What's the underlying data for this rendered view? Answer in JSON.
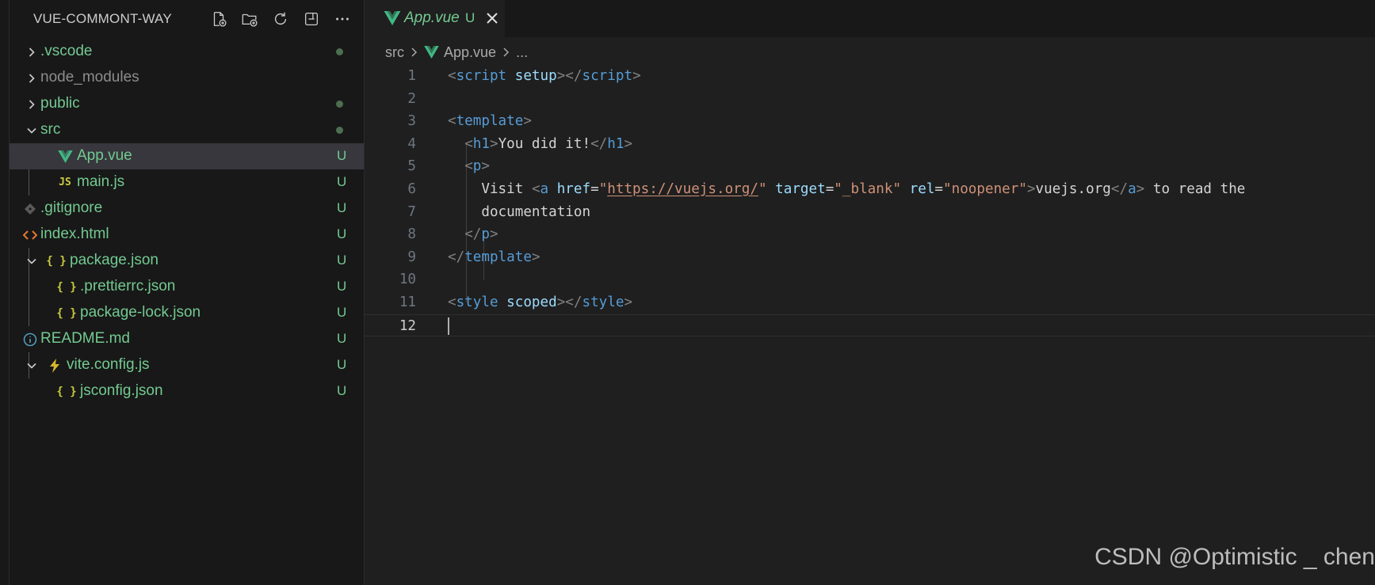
{
  "explorer": {
    "title": "VUE-COMMONT-WAY",
    "actions": [
      "new-file-icon",
      "new-folder-icon",
      "refresh-icon",
      "collapse-all-icon",
      "more-icon"
    ],
    "items": [
      {
        "name": ".vscode",
        "kind": "folder",
        "expanded": false,
        "indent": 0,
        "status": "dot",
        "color": "#73c991"
      },
      {
        "name": "node_modules",
        "kind": "folder",
        "expanded": false,
        "indent": 0,
        "status": "",
        "color": "#8c8c8c"
      },
      {
        "name": "public",
        "kind": "folder",
        "expanded": false,
        "indent": 0,
        "status": "dot",
        "color": "#73c991"
      },
      {
        "name": "src",
        "kind": "folder",
        "expanded": true,
        "indent": 0,
        "status": "dot",
        "color": "#73c991"
      },
      {
        "name": "App.vue",
        "kind": "vue",
        "indent": 1,
        "status": "U",
        "color": "#73c991",
        "selected": true
      },
      {
        "name": "main.js",
        "kind": "js",
        "indent": 1,
        "status": "U",
        "color": "#73c991"
      },
      {
        "name": ".gitignore",
        "kind": "git",
        "indent": 0,
        "status": "U",
        "color": "#73c991"
      },
      {
        "name": "index.html",
        "kind": "html",
        "indent": 0,
        "status": "U",
        "color": "#73c991"
      },
      {
        "name": "package.json",
        "kind": "json",
        "expanded": true,
        "indent": 0,
        "status": "U",
        "color": "#73c991"
      },
      {
        "name": ".prettierrc.json",
        "kind": "json",
        "indent": 1,
        "status": "U",
        "color": "#73c991"
      },
      {
        "name": "package-lock.json",
        "kind": "json",
        "indent": 1,
        "status": "U",
        "color": "#73c991"
      },
      {
        "name": "README.md",
        "kind": "info",
        "indent": 0,
        "status": "U",
        "color": "#73c991"
      },
      {
        "name": "vite.config.js",
        "kind": "vite",
        "expanded": true,
        "indent": 0,
        "status": "U",
        "color": "#73c991"
      },
      {
        "name": "jsconfig.json",
        "kind": "json",
        "indent": 1,
        "status": "U",
        "color": "#73c991"
      }
    ]
  },
  "tab": {
    "label": "App.vue",
    "status": "U",
    "close_icon": "close-icon"
  },
  "breadcrumb": {
    "folder": "src",
    "file": "App.vue",
    "more": "..."
  },
  "editor": {
    "active_line": 12,
    "lines": [
      {
        "n": "1",
        "tokens": [
          [
            "br",
            "<"
          ],
          [
            "tag",
            "script"
          ],
          [
            "t",
            " "
          ],
          [
            "attr",
            "setup"
          ],
          [
            "br",
            "></"
          ],
          [
            "tag",
            "script"
          ],
          [
            "br",
            ">"
          ]
        ]
      },
      {
        "n": "2",
        "tokens": []
      },
      {
        "n": "3",
        "tokens": [
          [
            "br",
            "<"
          ],
          [
            "tag",
            "template"
          ],
          [
            "br",
            ">"
          ]
        ]
      },
      {
        "n": "4",
        "tokens": [
          [
            "t",
            "  "
          ],
          [
            "br",
            "<"
          ],
          [
            "tag",
            "h1"
          ],
          [
            "br",
            ">"
          ],
          [
            "t",
            "You did it!"
          ],
          [
            "br",
            "</"
          ],
          [
            "tag",
            "h1"
          ],
          [
            "br",
            ">"
          ]
        ]
      },
      {
        "n": "5",
        "tokens": [
          [
            "t",
            "  "
          ],
          [
            "br",
            "<"
          ],
          [
            "tag",
            "p"
          ],
          [
            "br",
            ">"
          ]
        ]
      },
      {
        "n": "6",
        "tokens": [
          [
            "t",
            "    Visit "
          ],
          [
            "br",
            "<"
          ],
          [
            "tag",
            "a"
          ],
          [
            "t",
            " "
          ],
          [
            "attr",
            "href"
          ],
          [
            "t",
            "="
          ],
          [
            "str",
            "\""
          ],
          [
            "url",
            "https://vuejs.org/"
          ],
          [
            "str",
            "\""
          ],
          [
            "t",
            " "
          ],
          [
            "attr",
            "target"
          ],
          [
            "t",
            "="
          ],
          [
            "str",
            "\"_blank\""
          ],
          [
            "t",
            " "
          ],
          [
            "attr",
            "rel"
          ],
          [
            "t",
            "="
          ],
          [
            "str",
            "\"noopener\""
          ],
          [
            "br",
            ">"
          ],
          [
            "t",
            "vuejs.org"
          ],
          [
            "br",
            "</"
          ],
          [
            "tag",
            "a"
          ],
          [
            "br",
            ">"
          ],
          [
            "t",
            " to read the"
          ]
        ]
      },
      {
        "n": "7",
        "tokens": [
          [
            "t",
            "    documentation"
          ]
        ]
      },
      {
        "n": "8",
        "tokens": [
          [
            "t",
            "  "
          ],
          [
            "br",
            "</"
          ],
          [
            "tag",
            "p"
          ],
          [
            "br",
            ">"
          ]
        ]
      },
      {
        "n": "9",
        "tokens": [
          [
            "br",
            "</"
          ],
          [
            "tag",
            "template"
          ],
          [
            "br",
            ">"
          ]
        ]
      },
      {
        "n": "10",
        "tokens": []
      },
      {
        "n": "11",
        "tokens": [
          [
            "br",
            "<"
          ],
          [
            "tag",
            "style"
          ],
          [
            "t",
            " "
          ],
          [
            "attr",
            "scoped"
          ],
          [
            "br",
            "></"
          ],
          [
            "tag",
            "style"
          ],
          [
            "br",
            ">"
          ]
        ]
      },
      {
        "n": "12",
        "tokens": []
      }
    ]
  },
  "watermark": "CSDN @Optimistic _ chen",
  "colors": {
    "git_untracked": "#73c991",
    "vue": "#41b883",
    "js": "#cbcb41",
    "html": "#e37933",
    "json": "#cbcb41",
    "info": "#519aba"
  }
}
